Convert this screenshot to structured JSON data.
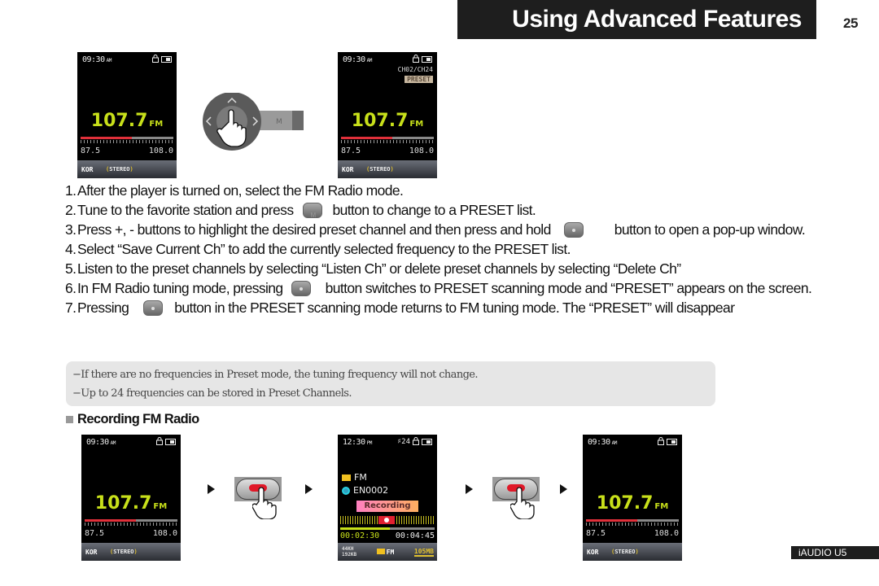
{
  "header": {
    "title": "Using Advanced Features",
    "page_number": "25"
  },
  "screens": {
    "tuning": {
      "time": "09:30",
      "ampm": "AM",
      "frequency": "107.7",
      "band": "FM",
      "range_min": "87.5",
      "range_max": "108.0",
      "tune_position": 0.55,
      "region": "KOR",
      "stereo": "STEREO"
    },
    "preset": {
      "time": "09:30",
      "ampm": "AM",
      "channel": "CH02/CH24",
      "preset_badge": "PRESET",
      "frequency": "107.7",
      "band": "FM",
      "range_min": "87.5",
      "range_max": "108.0",
      "tune_position": 0.55,
      "region": "KOR",
      "stereo": "STEREO"
    },
    "rec_before": {
      "time": "09:30",
      "ampm": "AM",
      "frequency": "107.7",
      "band": "FM",
      "range_min": "87.5",
      "range_max": "108.0",
      "tune_position": 0.55,
      "region": "KOR",
      "stereo": "STEREO"
    },
    "recording": {
      "time": "12:30",
      "ampm": "PM",
      "volume": "24",
      "folder": "FM",
      "file": "EN0002",
      "status": "Recording",
      "elapsed": "00:02:30",
      "total": "00:04:45",
      "progress": 0.53,
      "sample_rate": "44KH",
      "bitrate": "192KB",
      "source": "FM",
      "memory": "105MB"
    },
    "rec_after": {
      "time": "09:30",
      "ampm": "AM",
      "frequency": "107.7",
      "band": "FM",
      "range_min": "87.5",
      "range_max": "108.0",
      "tune_position": 0.55,
      "region": "KOR",
      "stereo": "STEREO"
    }
  },
  "controls": {
    "dial_button_label": "M"
  },
  "steps": [
    {
      "num": "1.",
      "text": "After the player is turned on, select the FM Radio mode."
    },
    {
      "num": "2.",
      "before": "Tune to the favorite station and press",
      "icon": "m-button-icon",
      "after": "button to change to a PRESET list."
    },
    {
      "num": "3.",
      "before": "Press +, - buttons to highlight the desired preset channel and then press and hold",
      "icon": "center-button-icon",
      "after": "button to open a pop-up window."
    },
    {
      "num": "4.",
      "text": "Select “Save Current Ch” to add the currently selected frequency to the PRESET list."
    },
    {
      "num": "5.",
      "text": "Listen to the preset channels by selecting “Listen Ch” or delete preset channels by selecting “Delete Ch”"
    },
    {
      "num": "6.",
      "before": "In FM Radio tuning mode, pressing",
      "icon": "center-button-icon",
      "after": "button switches to PRESET scanning mode and “PRESET” appears on the screen."
    },
    {
      "num": "7.",
      "before": "Pressing",
      "icon": "center-button-icon",
      "after": "button in the PRESET scanning mode returns to FM tuning mode. The “PRESET” will disappear"
    }
  ],
  "notes": [
    "−If there are no frequencies in Preset mode, the tuning frequency will not change.",
    "−Up to 24 frequencies can be stored in Preset Channels."
  ],
  "section": {
    "title": "Recording FM Radio"
  },
  "footer": {
    "model": "iAUDIO U5"
  },
  "colors": {
    "frequency": "#c8e01a",
    "tune_fill": "#e0303a",
    "record_button": "#e01828",
    "header_bg": "#1e1e1e",
    "note_bg": "#e6e6e6"
  }
}
